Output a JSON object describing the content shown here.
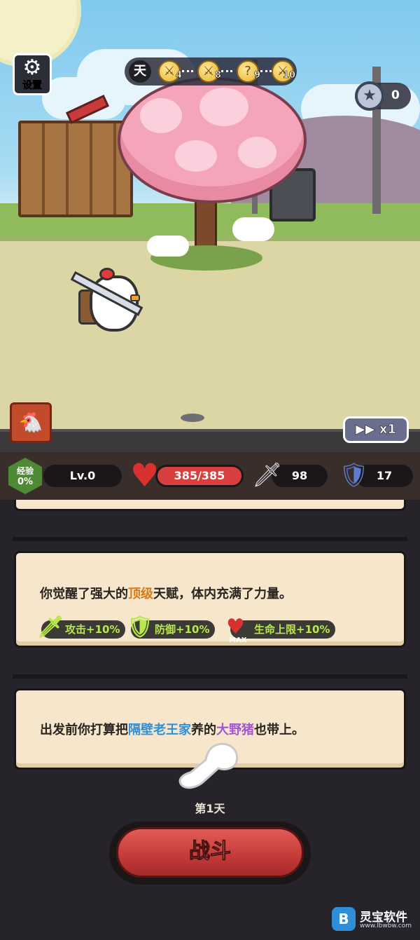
{
  "hud": {
    "settings_label": "设置",
    "day_label": "天",
    "stages": [
      {
        "number": "4",
        "icon": "sword-coin-icon"
      },
      {
        "number": "8",
        "icon": "sword-coin-icon"
      },
      {
        "number": "9",
        "icon": "question-coin-icon"
      },
      {
        "number": "10",
        "icon": "sword-coin-icon"
      }
    ],
    "star_count": "0",
    "speed_label": "x1"
  },
  "stats": {
    "exp_label": "经验",
    "exp_percent": "0%",
    "level": "Lv.0",
    "hp": "385/385",
    "attack": "98",
    "defense": "17"
  },
  "events": [
    {
      "text_before": "你觉醒了强大的",
      "highlight": "顶级",
      "text_after": "天赋，体内充满了力量。",
      "bonuses": [
        {
          "icon": "sword-icon",
          "label": "攻击+10%"
        },
        {
          "icon": "shield-icon",
          "label": "防御+10%"
        },
        {
          "icon": "max-heart-icon",
          "badge": "MAX",
          "label": "生命上限+10%"
        }
      ]
    },
    {
      "text_before": "出发前你打算把",
      "highlight_blue": "隔壁老王家",
      "text_middle": "养的",
      "highlight_purple": "大野猪",
      "text_after": "也带上。"
    }
  ],
  "day_caption": "第1天",
  "fight_label": "战斗",
  "watermark": {
    "name": "灵宝软件",
    "url": "www.lbwbw.com"
  },
  "colors": {
    "highlight_orange": "#d9781a",
    "highlight_blue": "#2f8fd8",
    "highlight_purple": "#a355d4",
    "bonus_green": "#b8e84a",
    "fight_red": "#c33a37",
    "hp_red": "#d84040"
  }
}
